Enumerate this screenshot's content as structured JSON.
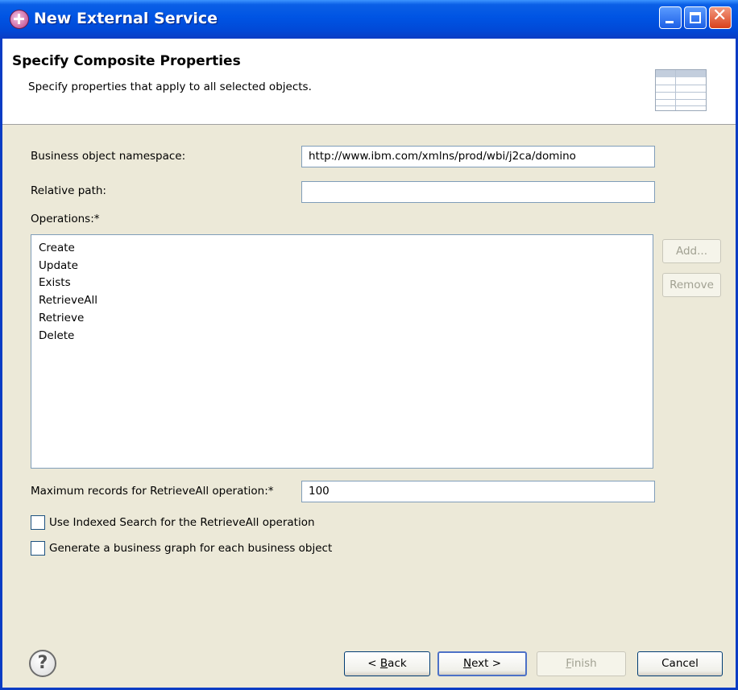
{
  "window": {
    "title": "New External Service"
  },
  "header": {
    "heading": "Specify Composite Properties",
    "description": "Specify properties that apply to all selected objects."
  },
  "form": {
    "namespace_label": "Business object namespace:",
    "namespace_value": "http://www.ibm.com/xmlns/prod/wbi/j2ca/domino",
    "relative_path_label": "Relative path:",
    "relative_path_value": "",
    "operations_label": "Operations:*",
    "operations": [
      "Create",
      "Update",
      "Exists",
      "RetrieveAll",
      "Retrieve",
      "Delete"
    ],
    "add_button": "Add...",
    "remove_button": "Remove",
    "max_records_label": "Maximum records for RetrieveAll operation:*",
    "max_records_value": "100",
    "indexed_search_label": "Use Indexed Search for the RetrieveAll operation",
    "indexed_search_checked": false,
    "business_graph_label": "Generate a business graph for each business object",
    "business_graph_checked": false
  },
  "footer": {
    "back_prefix": "< ",
    "back_mnemonic": "B",
    "back_rest": "ack",
    "next_mnemonic": "N",
    "next_rest": "ext >",
    "finish_mnemonic": "F",
    "finish_rest": "inish",
    "cancel": "Cancel"
  }
}
